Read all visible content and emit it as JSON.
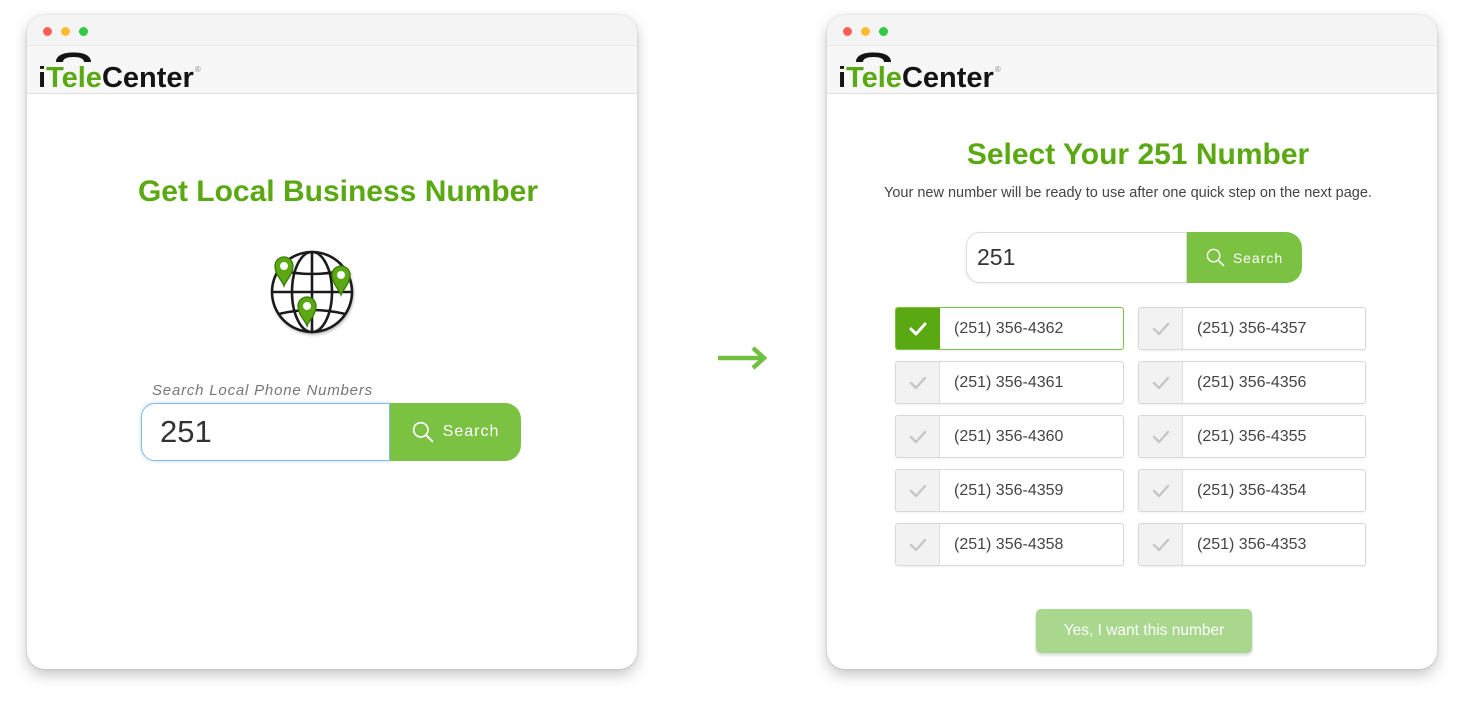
{
  "colors": {
    "accent": "#5aa812",
    "button": "#7cc242",
    "button_muted": "#a8d78d",
    "arrow": "#72c040",
    "input_focus": "#86bde6"
  },
  "brand": {
    "prefix": "i",
    "highlight": "Tele",
    "suffix": "Center",
    "mark": "®",
    "icon": "phone-handset-icon"
  },
  "search_page": {
    "title": "Get Local Business Number",
    "hero_icon": "globe-icon",
    "pin_icon": "map-pin-icon",
    "search_label": "Search Local Phone Numbers",
    "search_value": "251",
    "search_button": "Search",
    "search_icon": "search-icon"
  },
  "transition_icon": "right-arrow-icon",
  "results_page": {
    "title": "Select Your 251 Number",
    "subtitle": "Your new number will be ready to use after one quick step on the next page.",
    "search_value": "251",
    "search_button": "Search",
    "search_icon": "search-icon",
    "option_icon": "check-icon",
    "number_columns": [
      [
        {
          "number": "(251) 356-4362",
          "selected": true
        },
        {
          "number": "(251) 356-4361",
          "selected": false
        },
        {
          "number": "(251) 356-4360",
          "selected": false
        },
        {
          "number": "(251) 356-4359",
          "selected": false
        },
        {
          "number": "(251) 356-4358",
          "selected": false
        }
      ],
      [
        {
          "number": "(251) 356-4357",
          "selected": false
        },
        {
          "number": "(251) 356-4356",
          "selected": false
        },
        {
          "number": "(251) 356-4355",
          "selected": false
        },
        {
          "number": "(251) 356-4354",
          "selected": false
        },
        {
          "number": "(251) 356-4353",
          "selected": false
        }
      ]
    ],
    "confirm_button": "Yes, I want this number"
  }
}
